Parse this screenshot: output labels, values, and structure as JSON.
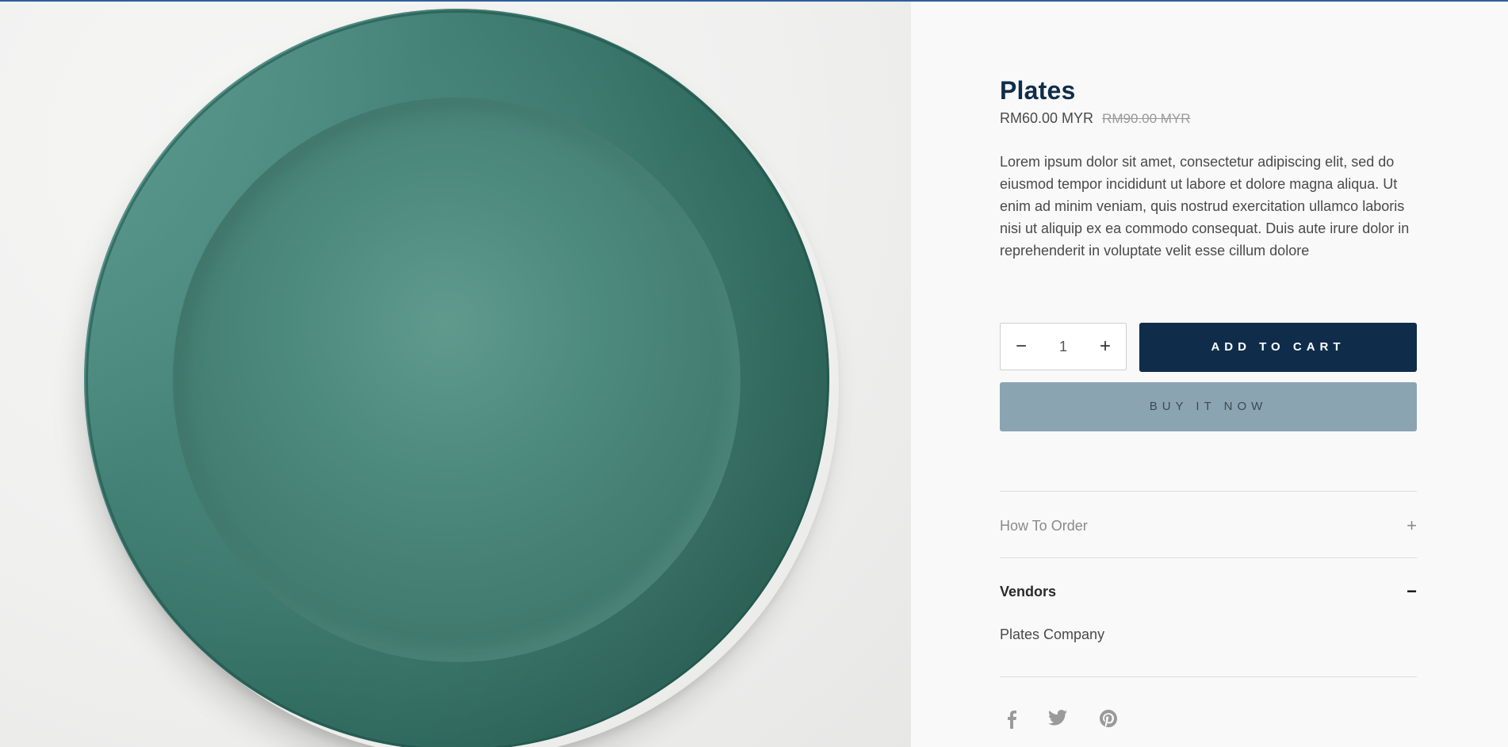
{
  "product": {
    "title": "Plates",
    "price": "RM60.00 MYR",
    "compare_at_price": "RM90.00 MYR",
    "description": "Lorem ipsum dolor sit amet, consectetur adipiscing elit, sed do eiusmod tempor incididunt ut labore et dolore magna aliqua. Ut enim ad minim veniam, quis nostrud exercitation ullamco laboris nisi ut aliquip ex ea commodo consequat. Duis aute irure dolor in reprehenderit in voluptate velit esse cillum dolore"
  },
  "quantity": {
    "minus_symbol": "−",
    "value": "1",
    "plus_symbol": "+"
  },
  "buttons": {
    "add_to_cart": "ADD TO CART",
    "buy_now": "BUY IT NOW"
  },
  "accordion": {
    "how_to_order": {
      "label": "How To Order",
      "toggle": "+",
      "expanded": false
    },
    "vendors": {
      "label": "Vendors",
      "toggle": "−",
      "expanded": true,
      "content": "Plates Company"
    }
  },
  "social": {
    "icons": [
      "facebook-icon",
      "twitter-icon",
      "pinterest-icon"
    ]
  },
  "colors": {
    "brand_navy": "#0f2d4a",
    "buy_now_bg": "#8aa5b1",
    "accent_top_bar": "#2f5e9c"
  }
}
